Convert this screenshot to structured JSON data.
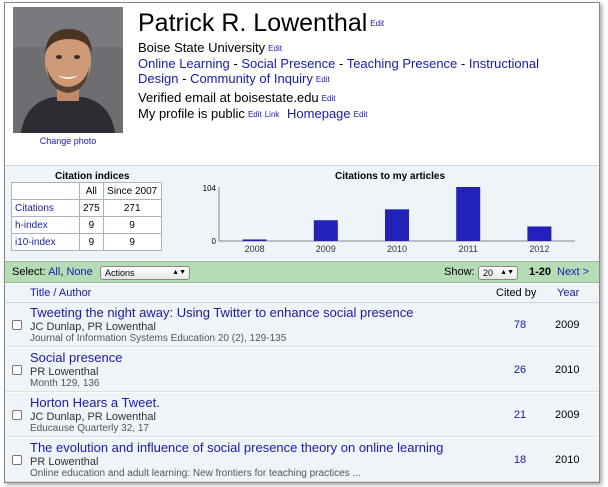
{
  "profile": {
    "name": "Patrick R. Lowenthal",
    "edit_label": "Edit",
    "link_label": "Link",
    "change_photo": "Change photo",
    "affiliation": "Boise State University",
    "interests": [
      "Online Learning",
      "Social Presence",
      "Teaching Presence",
      "Instructional Design",
      "Community of Inquiry"
    ],
    "interest_separator": "-",
    "verified_email": "Verified email at boisestate.edu",
    "public_text": "My profile is public",
    "homepage": "Homepage"
  },
  "citation_indices": {
    "title": "Citation indices",
    "columns": [
      "",
      "All",
      "Since 2007"
    ],
    "rows": [
      {
        "label": "Citations",
        "all": "275",
        "since": "271"
      },
      {
        "label": "h-index",
        "all": "9",
        "since": "9"
      },
      {
        "label": "i10-index",
        "all": "9",
        "since": "9"
      }
    ]
  },
  "chart_data": {
    "type": "bar",
    "title": "Citations to my articles",
    "categories": [
      "2008",
      "2009",
      "2010",
      "2011",
      "2012"
    ],
    "values": [
      3,
      40,
      61,
      104,
      28
    ],
    "ylim": [
      0,
      104
    ],
    "yticks": [
      "104",
      "0"
    ],
    "bar_color": "#2222bb",
    "grid": false
  },
  "toolbar": {
    "select_label": "Select:",
    "select_all": "All",
    "select_none": "None",
    "actions_label": "Actions",
    "show_label": "Show:",
    "show_value": "20",
    "range": "1-20",
    "next": "Next >"
  },
  "articles": {
    "header": {
      "title_author": "Title / Author",
      "cited_by": "Cited by",
      "year": "Year"
    },
    "items": [
      {
        "title": "Tweeting the night away: Using Twitter to enhance social presence",
        "authors": "JC Dunlap, PR Lowenthal",
        "venue": "Journal of Information Systems Education 20 (2), 129-135",
        "cited_by": "78",
        "year": "2009"
      },
      {
        "title": "Social presence",
        "authors": "PR Lowenthal",
        "venue": "Month 129, 136",
        "cited_by": "26",
        "year": "2010"
      },
      {
        "title": "Horton Hears a Tweet.",
        "authors": "JC Dunlap, PR Lowenthal",
        "venue": "Educause Quarterly 32, 17",
        "cited_by": "21",
        "year": "2009"
      },
      {
        "title": "The evolution and influence of social presence theory on online learning",
        "authors": "PR Lowenthal",
        "venue": "Online education and adult learning: New frontiers for teaching practices ...",
        "cited_by": "18",
        "year": "2010"
      }
    ]
  },
  "colors": {
    "link": "#1a1aa6",
    "toolbar_bg": "#b7dbb5",
    "panel_bg": "#eef4f8"
  }
}
